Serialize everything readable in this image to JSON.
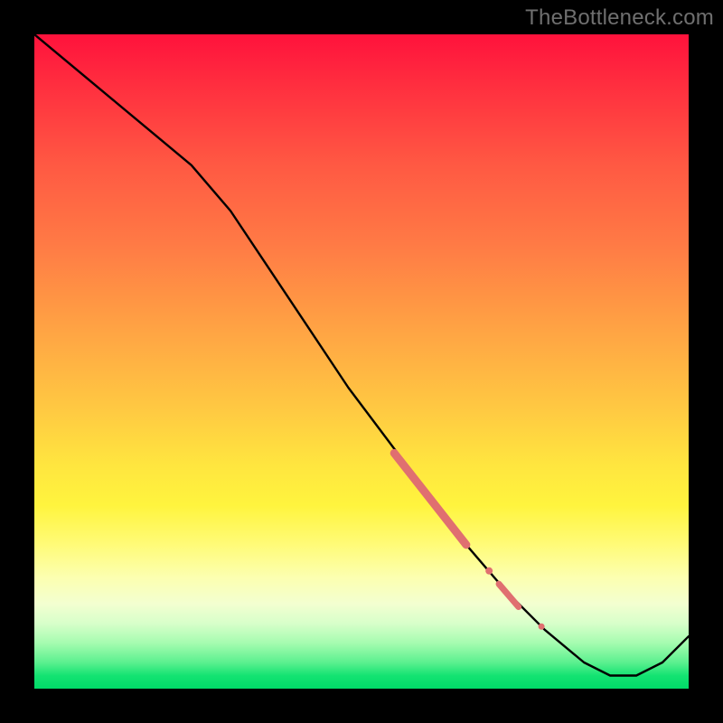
{
  "watermark": "TheBottleneck.com",
  "colors": {
    "frame_bg": "#000000",
    "line": "#000000",
    "marker": "#e06f70",
    "gradient_top": "#ff123c",
    "gradient_bottom": "#00db68"
  },
  "chart_data": {
    "type": "line",
    "title": "",
    "xlabel": "",
    "ylabel": "",
    "xlim": [
      0,
      100
    ],
    "ylim": [
      0,
      100
    ],
    "grid": false,
    "legend": false,
    "series": [
      {
        "name": "curve",
        "x": [
          0,
          6,
          12,
          18,
          24,
          30,
          36,
          42,
          48,
          54,
          60,
          66,
          72,
          78,
          84,
          88,
          92,
          96,
          100
        ],
        "y": [
          100,
          95,
          90,
          85,
          80,
          73,
          64,
          55,
          46,
          38,
          30,
          22,
          15,
          9,
          4,
          2,
          2,
          4,
          8
        ]
      }
    ],
    "markers": [
      {
        "name": "segment-main",
        "type": "segment",
        "x0": 55,
        "y0": 36,
        "x1": 66,
        "y1": 22,
        "width": 9
      },
      {
        "name": "dot-upper",
        "type": "dot",
        "x": 69.5,
        "y": 18.0,
        "r": 4.0
      },
      {
        "name": "segment-mid",
        "type": "segment",
        "x0": 71,
        "y0": 16,
        "x1": 74,
        "y1": 12.5,
        "width": 7
      },
      {
        "name": "dot-lower",
        "type": "dot",
        "x": 77.5,
        "y": 9.5,
        "r": 3.5
      }
    ]
  }
}
